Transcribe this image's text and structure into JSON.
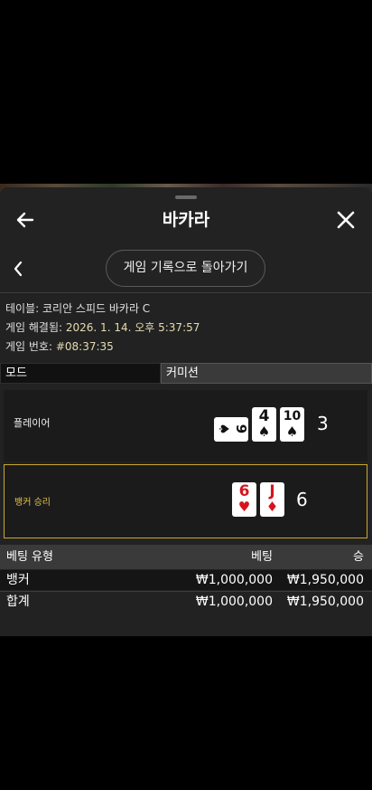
{
  "header": {
    "title": "바카라",
    "back_icon": "arrow-left-icon",
    "close_icon": "close-icon"
  },
  "nav": {
    "history_button": "게임 기록으로 돌아가기",
    "back_icon": "chevron-left-icon"
  },
  "info": {
    "table_label": "테이블:",
    "table_value": "코리안 스피드 바카라 C",
    "resolved_label": "게임 해결됨:",
    "resolved_value": "2026. 1. 14. 오후 5:37:57",
    "number_label": "게임 번호:",
    "number_value": "#08:37:35"
  },
  "tabs": {
    "mode": "모드",
    "commission": "커미션"
  },
  "player": {
    "label": "플레이어",
    "score": "3",
    "cards": [
      {
        "rank": "9",
        "suit": "♠",
        "sideways": true
      },
      {
        "rank": "4",
        "suit": "♠"
      },
      {
        "rank": "10",
        "suit": "♠"
      }
    ]
  },
  "banker": {
    "label": "뱅커 승리",
    "score": "6",
    "cards": [
      {
        "rank": "6",
        "suit": "♥"
      },
      {
        "rank": "J",
        "suit": "♦"
      }
    ]
  },
  "bets": {
    "headers": {
      "type": "베팅 유형",
      "bet": "베팅",
      "win": "승"
    },
    "rows": [
      {
        "type": "뱅커",
        "bet": "₩1,000,000",
        "win": "₩1,950,000"
      },
      {
        "type": "합계",
        "bet": "₩1,000,000",
        "win": "₩1,950,000"
      }
    ]
  },
  "colors": {
    "accent_gold": "#c9a82e",
    "red_suit": "#d4151f"
  }
}
